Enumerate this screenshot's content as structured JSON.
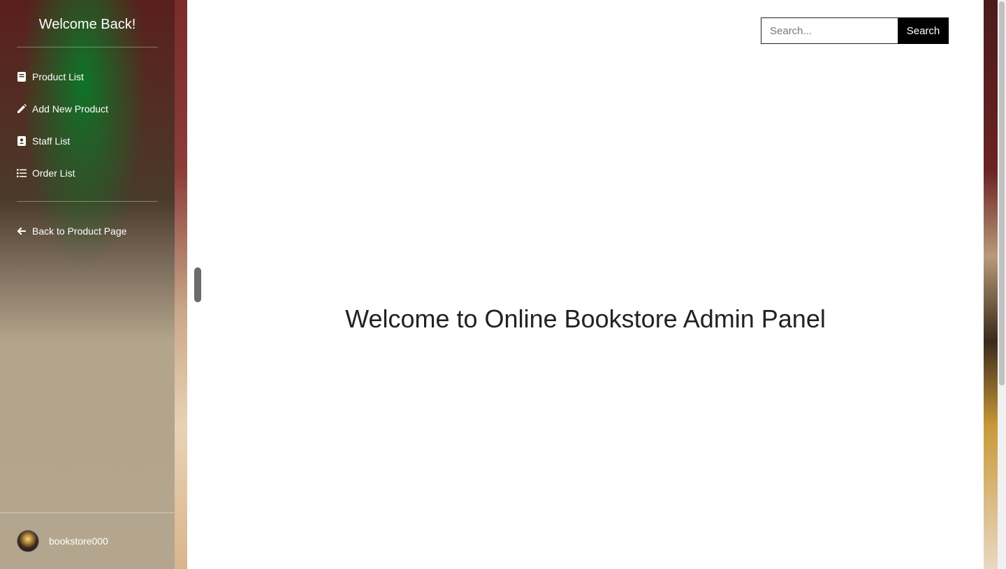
{
  "sidebar": {
    "title": "Welcome Back!",
    "items": [
      {
        "label": "Product List",
        "icon": "book-icon"
      },
      {
        "label": "Add New Product",
        "icon": "pencil-icon"
      },
      {
        "label": "Staff List",
        "icon": "contact-card-icon"
      },
      {
        "label": "Order List",
        "icon": "list-icon"
      }
    ],
    "back_label": "Back to Product Page",
    "back_icon": "arrow-left-icon",
    "user": {
      "name": "bookstore000"
    }
  },
  "header": {
    "search_placeholder": "Search...",
    "search_button": "Search"
  },
  "main": {
    "heading": "Welcome to Online Bookstore Admin Panel"
  },
  "colors": {
    "search_button_bg": "#000000",
    "accent_green": "#0a7828",
    "heading_text": "#222222"
  }
}
